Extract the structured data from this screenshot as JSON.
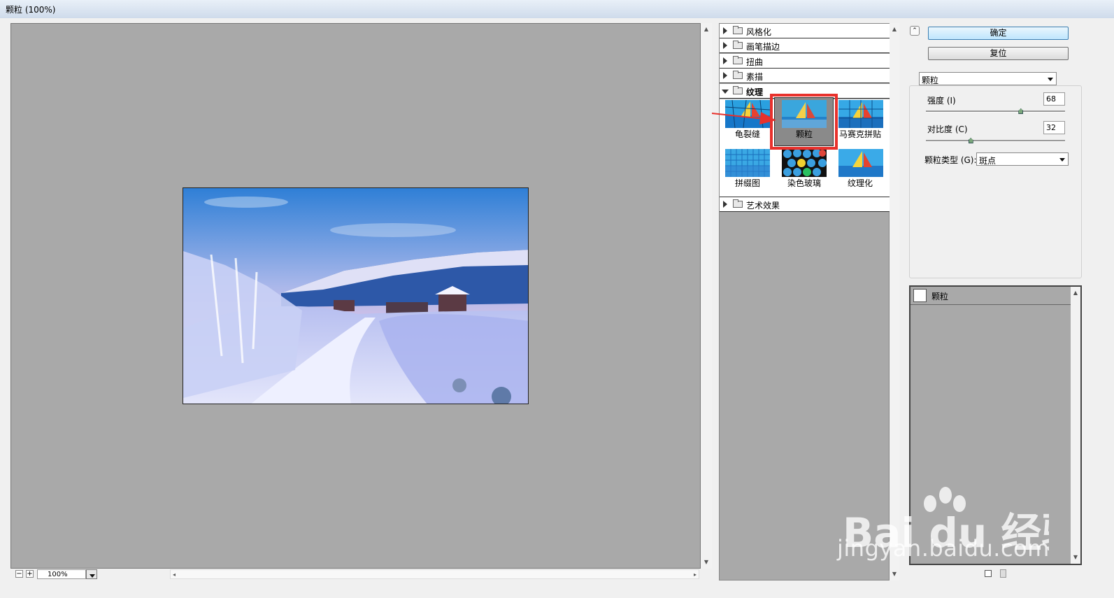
{
  "window": {
    "title": "颗粒 (100%)"
  },
  "preview": {
    "zoom": "100%"
  },
  "filter_list": {
    "categories": [
      {
        "label": "风格化",
        "expanded": false
      },
      {
        "label": "画笔描边",
        "expanded": false
      },
      {
        "label": "扭曲",
        "expanded": false
      },
      {
        "label": "素描",
        "expanded": false
      },
      {
        "label": "纹理",
        "expanded": true
      },
      {
        "label": "艺术效果",
        "expanded": false
      }
    ],
    "texture_filters": [
      "龟裂缝",
      "颗粒",
      "马赛克拼贴",
      "拼缀图",
      "染色玻璃",
      "纹理化"
    ],
    "selected": "颗粒"
  },
  "buttons": {
    "ok": "确定",
    "reset": "复位"
  },
  "settings": {
    "filter_name": "颗粒",
    "intensity": {
      "label": "强度 (I)",
      "value": "68",
      "fraction": 0.68
    },
    "contrast": {
      "label": "对比度 (C)",
      "value": "32",
      "fraction": 0.32
    },
    "grain_type": {
      "label": "颗粒类型 (G):",
      "value": "斑点"
    }
  },
  "layers": {
    "items": [
      "颗粒"
    ]
  },
  "watermark": {
    "brand": "Bai du 经验",
    "url": "jingyan.baidu.com"
  },
  "colors": {
    "highlight": "#e8312c",
    "panel_gray": "#a9a9a9",
    "ok_button": "#bee6fd"
  }
}
